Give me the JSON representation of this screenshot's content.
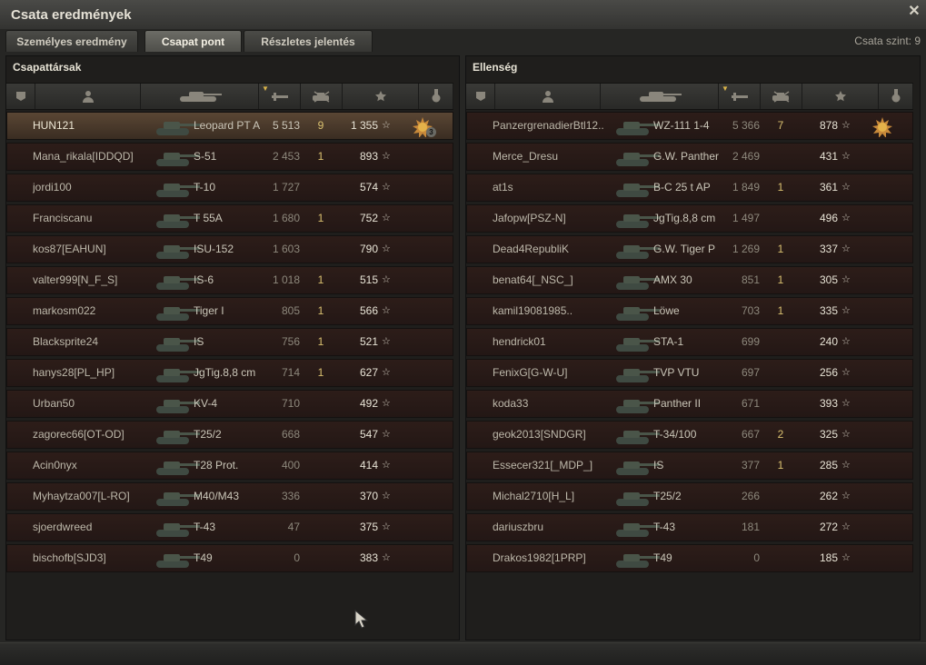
{
  "window": {
    "title": "Csata eredmények",
    "level": "Csata szint: 9"
  },
  "tabs": [
    {
      "label": "Személyes eredmény"
    },
    {
      "label": "Csapat pont"
    },
    {
      "label": "Részletes jelentés"
    }
  ],
  "active_tab": "Csapat pont",
  "columns": [
    "squad-icon",
    "player-icon",
    "tank-icon",
    "damage-icon",
    "kills-icon",
    "experience-icon",
    "medal-icon"
  ],
  "allies": {
    "title": "Csapattársak",
    "players": [
      {
        "name": "HUN121",
        "vehicle": "Leopard PT A",
        "damage": "5 513",
        "kills": "9",
        "xp": "1 355",
        "medal": "3"
      },
      {
        "name": "Mana_rikala[IDDQD]",
        "vehicle": "S-51",
        "damage": "2 453",
        "kills": "1",
        "xp": "893"
      },
      {
        "name": "jordi100",
        "vehicle": "T-10",
        "damage": "1 727",
        "kills": "",
        "xp": "574"
      },
      {
        "name": "Franciscanu",
        "vehicle": "T 55A",
        "damage": "1 680",
        "kills": "1",
        "xp": "752"
      },
      {
        "name": "kos87[EAHUN]",
        "vehicle": "ISU-152",
        "damage": "1 603",
        "kills": "",
        "xp": "790"
      },
      {
        "name": "valter999[N_F_S]",
        "vehicle": "IS-6",
        "damage": "1 018",
        "kills": "1",
        "xp": "515"
      },
      {
        "name": "markosm022",
        "vehicle": "Tiger I",
        "damage": "805",
        "kills": "1",
        "xp": "566"
      },
      {
        "name": "Blacksprite24",
        "vehicle": "IS",
        "damage": "756",
        "kills": "1",
        "xp": "521"
      },
      {
        "name": "hanys28[PL_HP]",
        "vehicle": "JgTig.8,8 cm",
        "damage": "714",
        "kills": "1",
        "xp": "627"
      },
      {
        "name": "Urban50",
        "vehicle": "KV-4",
        "damage": "710",
        "kills": "",
        "xp": "492"
      },
      {
        "name": "zagorec66[OT-OD]",
        "vehicle": "T25/2",
        "damage": "668",
        "kills": "",
        "xp": "547"
      },
      {
        "name": "Acin0nyx",
        "vehicle": "T28 Prot.",
        "damage": "400",
        "kills": "",
        "xp": "414"
      },
      {
        "name": "Myhaytza007[L-RO]",
        "vehicle": "M40/M43",
        "damage": "336",
        "kills": "",
        "xp": "370"
      },
      {
        "name": "sjoerdwreed",
        "vehicle": "T-43",
        "damage": "47",
        "kills": "",
        "xp": "375"
      },
      {
        "name": "bischofb[SJD3]",
        "vehicle": "T49",
        "damage": "0",
        "kills": "",
        "xp": "383"
      }
    ]
  },
  "enemies": {
    "title": "Ellenség",
    "players": [
      {
        "name": "PanzergrenadierBtl12..",
        "vehicle": "WZ-111 1-4",
        "damage": "5 366",
        "kills": "7",
        "xp": "878",
        "medal": ""
      },
      {
        "name": "Merce_Dresu",
        "vehicle": "G.W. Panther",
        "damage": "2 469",
        "kills": "",
        "xp": "431"
      },
      {
        "name": "at1s",
        "vehicle": "B-C 25 t AP",
        "damage": "1 849",
        "kills": "1",
        "xp": "361"
      },
      {
        "name": "Jafopw[PSZ-N]",
        "vehicle": "JgTig.8,8 cm",
        "damage": "1 497",
        "kills": "",
        "xp": "496"
      },
      {
        "name": "Dead4RepubliK",
        "vehicle": "G.W. Tiger P",
        "damage": "1 269",
        "kills": "1",
        "xp": "337"
      },
      {
        "name": "benat64[_NSC_]",
        "vehicle": "AMX 30",
        "damage": "851",
        "kills": "1",
        "xp": "305"
      },
      {
        "name": "kamil19081985..",
        "vehicle": "Löwe",
        "damage": "703",
        "kills": "1",
        "xp": "335"
      },
      {
        "name": "hendrick01",
        "vehicle": "STA-1",
        "damage": "699",
        "kills": "",
        "xp": "240"
      },
      {
        "name": "FenixG[G-W-U]",
        "vehicle": "TVP VTU",
        "damage": "697",
        "kills": "",
        "xp": "256"
      },
      {
        "name": "koda33",
        "vehicle": "Panther II",
        "damage": "671",
        "kills": "",
        "xp": "393"
      },
      {
        "name": "geok2013[SNDGR]",
        "vehicle": "T-34/100",
        "damage": "667",
        "kills": "2",
        "xp": "325"
      },
      {
        "name": "Essecer321[_MDP_]",
        "vehicle": "IS",
        "damage": "377",
        "kills": "1",
        "xp": "285"
      },
      {
        "name": "Michal2710[H_L]",
        "vehicle": "T25/2",
        "damage": "266",
        "kills": "",
        "xp": "262"
      },
      {
        "name": "dariuszbru",
        "vehicle": "T-43",
        "damage": "181",
        "kills": "",
        "xp": "272"
      },
      {
        "name": "Drakos1982[1PRP]",
        "vehicle": "T49",
        "damage": "0",
        "kills": "",
        "xp": "185"
      }
    ]
  },
  "colors": {
    "accent": "#d9b44a",
    "row": "#2a1c18",
    "highlight_row": "#4f3d2e"
  }
}
